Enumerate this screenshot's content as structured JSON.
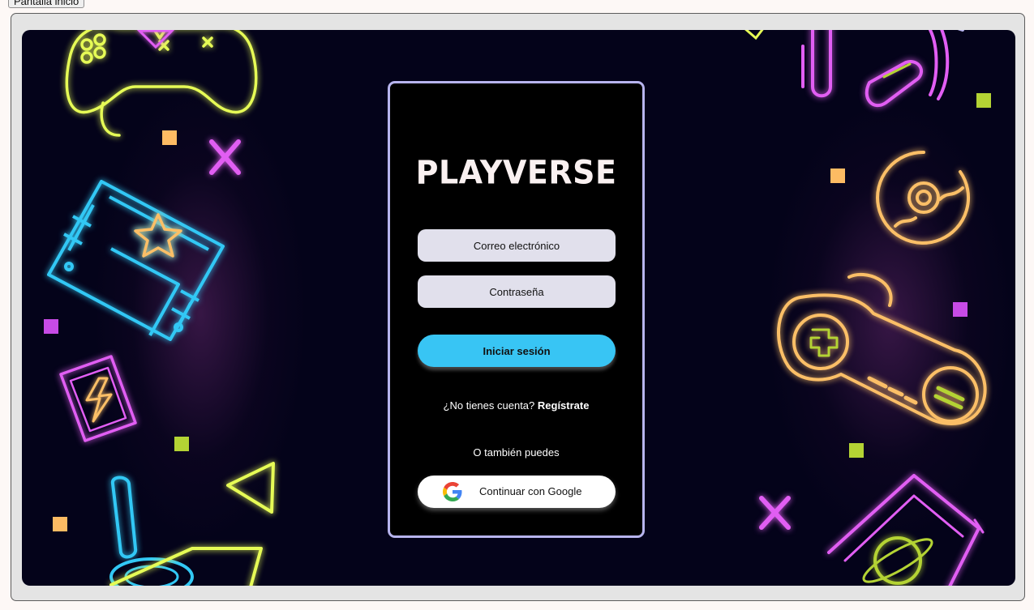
{
  "top_tab": {
    "label": "Pantalla inicio"
  },
  "card": {
    "logo": "PLAYVERSE",
    "email_placeholder": "Correo electrónico",
    "password_placeholder": "Contraseña",
    "login_button": "Iniciar sesión",
    "signup_prompt": "¿No tienes cuenta?",
    "signup_link": "Regístrate",
    "alt_text": "O también puedes",
    "google_button": "Continuar con Google"
  },
  "decorations": {
    "icons": [
      "gamepad-icon",
      "cartridge-icon",
      "joystick-icon",
      "headphones-icon",
      "disc-icon",
      "controller-icon",
      "game-cartridge-icon",
      "lightning-card-icon",
      "triangle-icon",
      "x-icon"
    ],
    "neon_colors": {
      "yellow": "#e6fb56",
      "cyan": "#32c8f5",
      "pink": "#e15ef3",
      "orange": "#fbbf67",
      "square_orange": "#fdbb63",
      "square_green": "#b4d334",
      "square_purple": "#c74be6"
    }
  },
  "colors": {
    "background": "#04031a",
    "card_border": "#b7b4ee",
    "field_bg": "#e1e0ec",
    "login_button": "#38c5f4"
  }
}
